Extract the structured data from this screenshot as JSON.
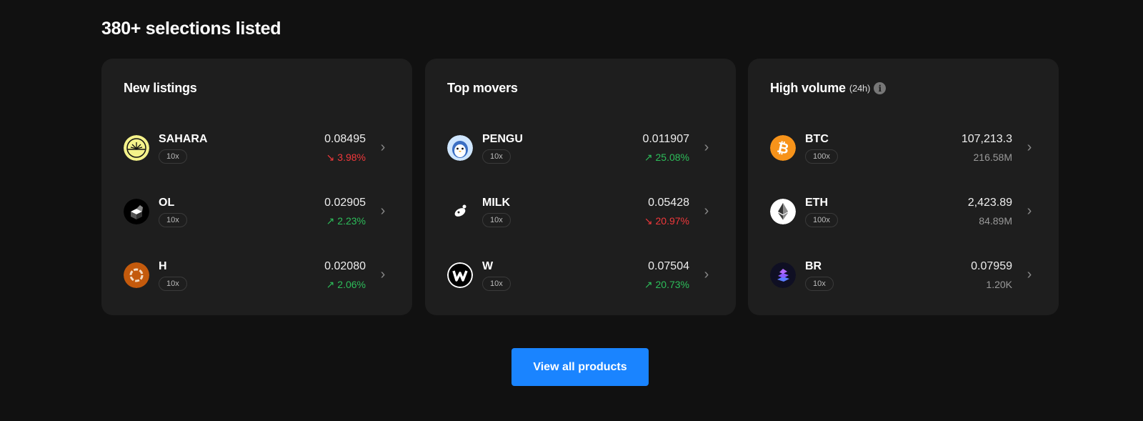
{
  "title": "380+ selections listed",
  "cards": [
    {
      "title": "New listings",
      "rows": [
        {
          "symbol": "SAHARA",
          "leverage": "10x",
          "price": "0.08495",
          "change": "3.98%",
          "dir": "down"
        },
        {
          "symbol": "OL",
          "leverage": "10x",
          "price": "0.02905",
          "change": "2.23%",
          "dir": "up"
        },
        {
          "symbol": "H",
          "leverage": "10x",
          "price": "0.02080",
          "change": "2.06%",
          "dir": "up"
        }
      ]
    },
    {
      "title": "Top movers",
      "rows": [
        {
          "symbol": "PENGU",
          "leverage": "10x",
          "price": "0.011907",
          "change": "25.08%",
          "dir": "up"
        },
        {
          "symbol": "MILK",
          "leverage": "10x",
          "price": "0.05428",
          "change": "20.97%",
          "dir": "down"
        },
        {
          "symbol": "W",
          "leverage": "10x",
          "price": "0.07504",
          "change": "20.73%",
          "dir": "up"
        }
      ]
    },
    {
      "title": "High volume",
      "subtitle": "(24h)",
      "rows": [
        {
          "symbol": "BTC",
          "leverage": "100x",
          "price": "107,213.3",
          "volume": "216.58M"
        },
        {
          "symbol": "ETH",
          "leverage": "100x",
          "price": "2,423.89",
          "volume": "84.89M"
        },
        {
          "symbol": "BR",
          "leverage": "10x",
          "price": "0.07959",
          "volume": "1.20K"
        }
      ]
    }
  ],
  "arrows": {
    "up": "↗",
    "down": "↘"
  },
  "button": "View all products",
  "colors": {
    "up": "#2dbd5a",
    "down": "#f0383b",
    "accent": "#1a84ff"
  }
}
